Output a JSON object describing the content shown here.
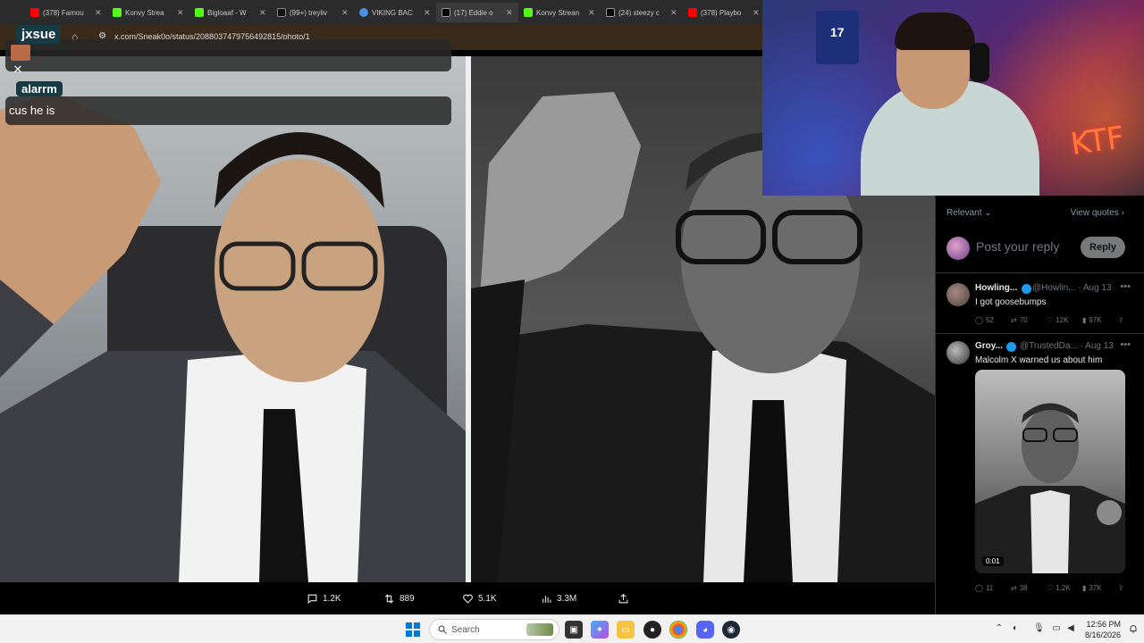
{
  "browser": {
    "tabs": [
      {
        "label": "(378) Famou",
        "color": "#ff0000"
      },
      {
        "label": "Konvy Strea",
        "color": "#53fc18"
      },
      {
        "label": "Bigloaaf - W",
        "color": "#53fc18"
      },
      {
        "label": "(99+) treyliv",
        "color": "#e0e0e0"
      },
      {
        "label": "VIKING BAC",
        "color": "#4a90e2"
      },
      {
        "label": "(17) Eddie o",
        "color": "#e0e0e0"
      },
      {
        "label": "Konvy Strean",
        "color": "#53fc18"
      },
      {
        "label": "(24) steezy c",
        "color": "#e0e0e0"
      },
      {
        "label": "(378) Playbo",
        "color": "#ff0000"
      }
    ],
    "url": "x.com/Sneak0o/status/2088037479756492815/photo/1"
  },
  "chat": {
    "user1": "jxsue",
    "user2": "alarrm",
    "message": "cus he is"
  },
  "post_actions": {
    "replies": "1.2K",
    "reposts": "889",
    "likes": "5.1K",
    "views": "3.3M"
  },
  "sidebar": {
    "sort_label": "Relevant",
    "view_quotes": "View quotes",
    "reply_placeholder": "Post your reply",
    "reply_button": "Reply",
    "replies": [
      {
        "name": "Howling...",
        "handle": "@Howlin...",
        "date": "· Aug 13",
        "text": "I got goosebumps",
        "replies": "52",
        "reposts": "70",
        "likes": "12K",
        "views": "97K"
      },
      {
        "name": "Groy...",
        "handle": "@TrustedDa...",
        "date": "· Aug 13",
        "text": "Malcolm X warned us about him",
        "media_time": "0:01",
        "replies": "11",
        "reposts": "38",
        "likes": "1.2K",
        "views": "37K"
      }
    ]
  },
  "webcam": {
    "shirt_number": "17",
    "sign_text": "KTF"
  },
  "taskbar": {
    "search_placeholder": "Search",
    "time": "12:56 PM",
    "date": "8/16/2026"
  },
  "colors": {
    "accent": "#1d9bf0",
    "chat_badge": "#163b44",
    "taskbar": "#f2f2f2"
  }
}
